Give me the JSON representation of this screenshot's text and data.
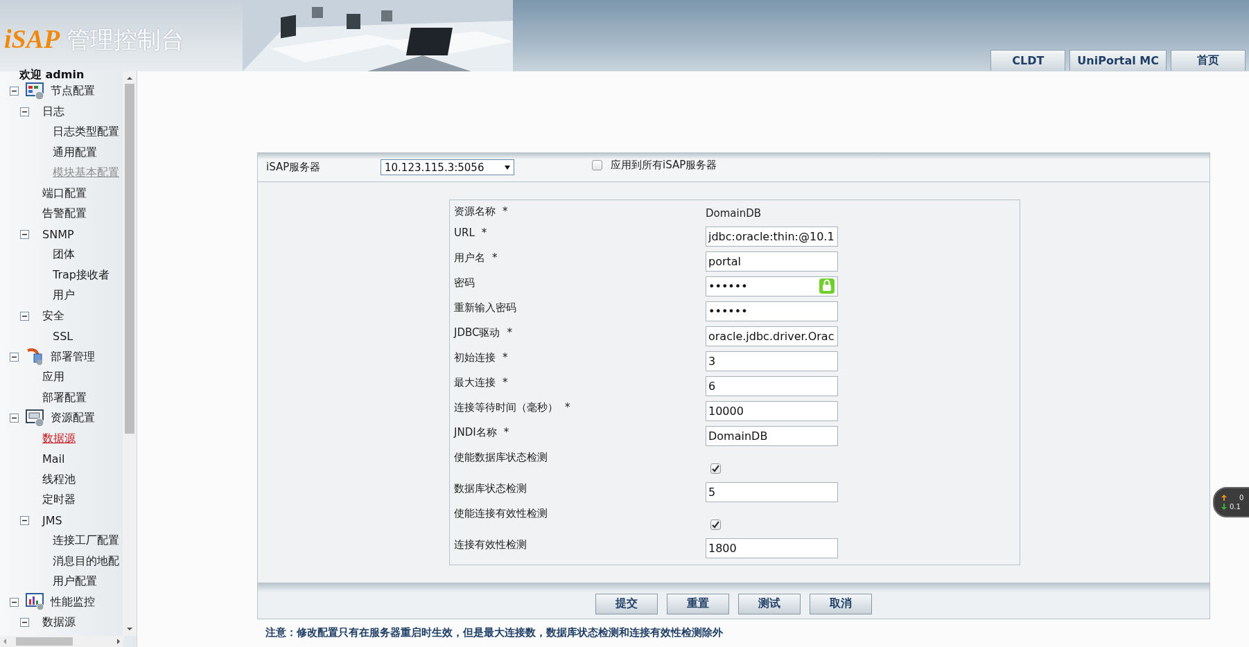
{
  "header": {
    "logo": "iSAP",
    "title": "管理控制台",
    "nav_buttons": [
      "CLDT",
      "UniPortal MC",
      "首页"
    ]
  },
  "sidebar": {
    "welcome": "欢迎 admin",
    "tree": [
      {
        "label": "节点配置",
        "selected": false,
        "disabled": false,
        "expanded": true,
        "children": [
          {
            "label": "日志",
            "selected": false,
            "disabled": false,
            "expanded": true,
            "children": [
              {
                "label": "日志类型配置",
                "selected": false,
                "disabled": false
              },
              {
                "label": "通用配置",
                "selected": false,
                "disabled": false
              },
              {
                "label": "模块基本配置",
                "selected": false,
                "disabled": true
              }
            ]
          },
          {
            "label": "端口配置",
            "selected": false,
            "disabled": false
          },
          {
            "label": "告警配置",
            "selected": false,
            "disabled": false
          },
          {
            "label": "SNMP",
            "selected": false,
            "disabled": false,
            "expanded": true,
            "children": [
              {
                "label": "团体",
                "selected": false,
                "disabled": false
              },
              {
                "label": "Trap接收者",
                "selected": false,
                "disabled": false
              },
              {
                "label": "用户",
                "selected": false,
                "disabled": false
              }
            ]
          },
          {
            "label": "安全",
            "selected": false,
            "disabled": false,
            "expanded": true,
            "children": [
              {
                "label": "SSL",
                "selected": false,
                "disabled": false
              }
            ]
          }
        ]
      },
      {
        "label": "部署管理",
        "selected": false,
        "disabled": false,
        "expanded": true,
        "children": [
          {
            "label": "应用",
            "selected": false,
            "disabled": false
          },
          {
            "label": "部署配置",
            "selected": false,
            "disabled": false
          }
        ]
      },
      {
        "label": "资源配置",
        "selected": false,
        "disabled": false,
        "expanded": true,
        "children": [
          {
            "label": "数据源",
            "selected": true,
            "disabled": false
          },
          {
            "label": "Mail",
            "selected": false,
            "disabled": false
          },
          {
            "label": "线程池",
            "selected": false,
            "disabled": false
          },
          {
            "label": "定时器",
            "selected": false,
            "disabled": false
          },
          {
            "label": "JMS",
            "selected": false,
            "disabled": false,
            "expanded": true,
            "children": [
              {
                "label": "连接工厂配置",
                "selected": false,
                "disabled": false
              },
              {
                "label": "消息目的地配",
                "selected": false,
                "disabled": false
              },
              {
                "label": "用户配置",
                "selected": false,
                "disabled": false
              }
            ]
          }
        ]
      },
      {
        "label": "性能监控",
        "selected": false,
        "disabled": false,
        "expanded": true,
        "children": [
          {
            "label": "数据源",
            "selected": false,
            "disabled": false,
            "expanded": true
          }
        ]
      }
    ]
  },
  "server_bar": {
    "label": "iSAP服务器",
    "server": "10.123.115.3:5056",
    "apply_all": {
      "label": "应用到所有iSAP服务器",
      "checked": false
    }
  },
  "form": {
    "fields": [
      {
        "kind": "static",
        "label": "资源名称",
        "required": true,
        "value": "DomainDB"
      },
      {
        "kind": "input",
        "label": "URL",
        "required": true,
        "value": "jdbc:oracle:thin:@10.1"
      },
      {
        "kind": "input",
        "label": "用户名",
        "required": true,
        "value": "portal"
      },
      {
        "kind": "password",
        "label": "密码",
        "required": false,
        "value": "••••••",
        "badge": true
      },
      {
        "kind": "password",
        "label": "重新输入密码",
        "required": false,
        "value": "••••••",
        "badge": false
      },
      {
        "kind": "input",
        "label": "JDBC驱动",
        "required": true,
        "value": "oracle.jdbc.driver.Orac"
      },
      {
        "kind": "input",
        "label": "初始连接",
        "required": true,
        "value": "3"
      },
      {
        "kind": "input",
        "label": "最大连接",
        "required": true,
        "value": "6"
      },
      {
        "kind": "input",
        "label": "连接等待时间（毫秒）",
        "required": true,
        "value": "10000"
      },
      {
        "kind": "input",
        "label": "JNDI名称",
        "required": true,
        "value": "DomainDB"
      },
      {
        "kind": "checkbox",
        "label": "使能数据库状态检测",
        "required": false,
        "checked": true
      },
      {
        "kind": "input",
        "label": "数据库状态检测",
        "required": false,
        "value": "5"
      },
      {
        "kind": "checkbox",
        "label": "使能连接有效性检测",
        "required": false,
        "checked": true
      },
      {
        "kind": "input",
        "label": "连接有效性检测",
        "required": false,
        "value": "1800"
      }
    ],
    "required_mark": "*",
    "buttons": [
      "提交",
      "重置",
      "测试",
      "取消"
    ],
    "note": "注意：修改配置只有在服务器重启时生效，但是最大连接数，数据库状态检测和连接有效性检测除外"
  },
  "speed_widget": {
    "up": "0",
    "down": "0.1"
  }
}
